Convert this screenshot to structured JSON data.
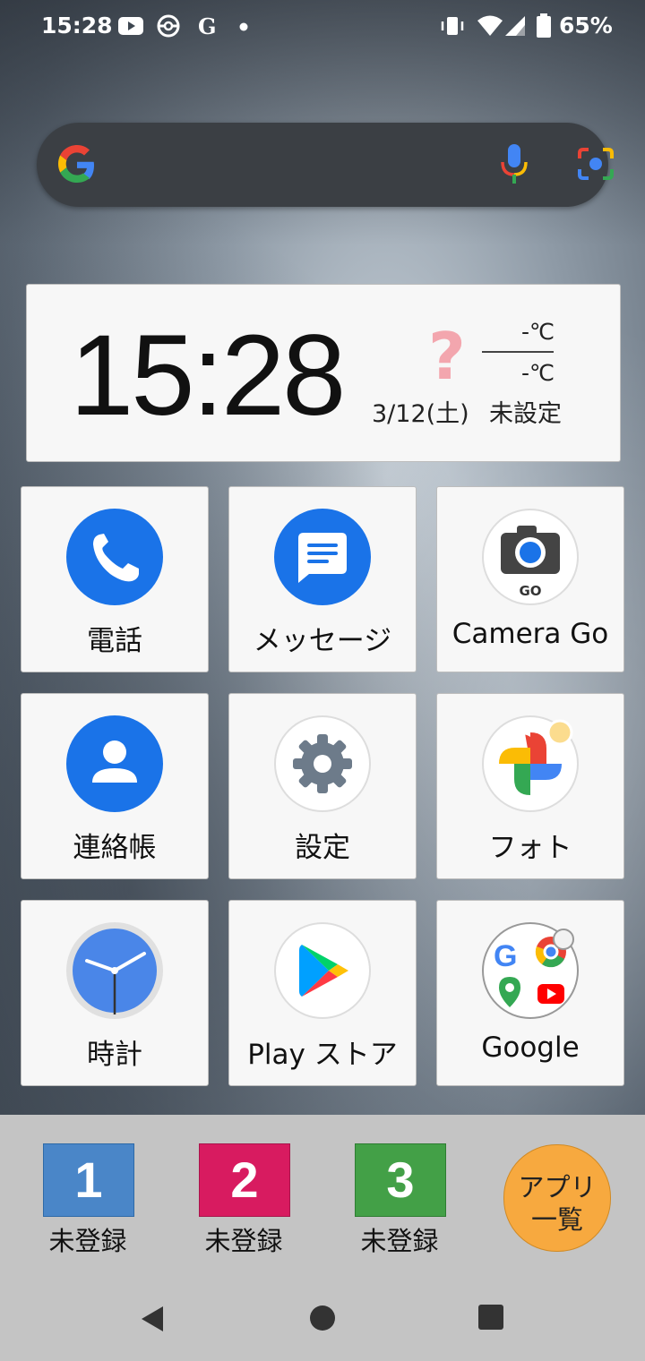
{
  "status_bar": {
    "time": "15:28",
    "battery_percent": "65%",
    "icons": [
      "youtube-icon",
      "pokeball-icon",
      "news-icon",
      "dot-icon",
      "vibrate-icon",
      "wifi-icon",
      "signal-icon",
      "battery-icon"
    ]
  },
  "search_bar": {
    "icons": [
      "google-g-icon",
      "mic-icon",
      "lens-icon"
    ]
  },
  "clock_widget": {
    "time": "15:28",
    "date": "3/12(土)",
    "weather_icon": "?",
    "temp_high": "-℃",
    "temp_low": "-℃",
    "location": "未設定"
  },
  "apps": [
    {
      "label": "電話",
      "icon": "phone-icon"
    },
    {
      "label": "メッセージ",
      "icon": "messages-icon"
    },
    {
      "label": "Camera Go",
      "icon": "camera-go-icon"
    },
    {
      "label": "連絡帳",
      "icon": "contacts-icon"
    },
    {
      "label": "設定",
      "icon": "settings-icon"
    },
    {
      "label": "フォト",
      "icon": "photos-icon"
    },
    {
      "label": "時計",
      "icon": "clock-icon"
    },
    {
      "label": "Play ストア",
      "icon": "play-store-icon"
    },
    {
      "label": "Google",
      "icon": "google-folder-icon"
    }
  ],
  "icon_text": {
    "camera_go_badge": "GO"
  },
  "speed_dial": [
    {
      "number": "1",
      "label": "未登録",
      "color": "#4a86c8"
    },
    {
      "number": "2",
      "label": "未登録",
      "color": "#d81b60"
    },
    {
      "number": "3",
      "label": "未登録",
      "color": "#43a047"
    }
  ],
  "all_apps_button": {
    "line1": "アプリ",
    "line2": "一覧",
    "color": "#f7a93f"
  },
  "nav_bar": {
    "icons": [
      "back-icon",
      "home-icon",
      "recents-icon"
    ]
  }
}
